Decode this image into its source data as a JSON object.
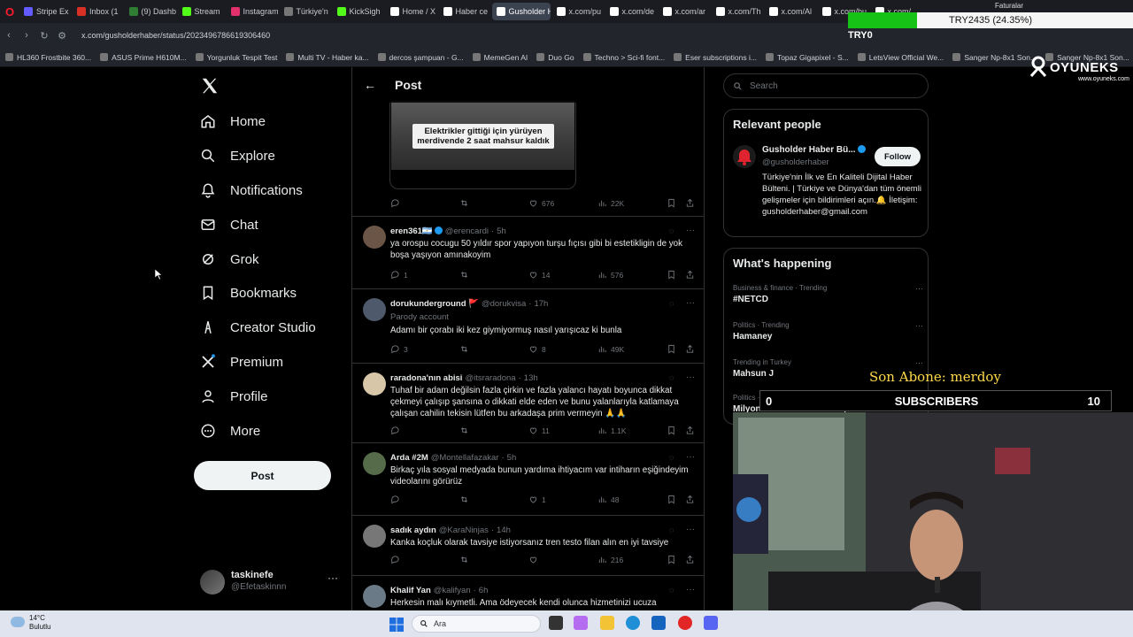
{
  "browser": {
    "tabs": [
      {
        "label": "Stripe Ex",
        "color": "#635bff",
        "active": false
      },
      {
        "label": "Inbox (1",
        "color": "#d93025",
        "active": false
      },
      {
        "label": "(9) Dashb",
        "color": "#2e7d32",
        "active": false
      },
      {
        "label": "Stream",
        "color": "#53fc18",
        "active": false
      },
      {
        "label": "Instagram",
        "color": "#e1306c",
        "active": false
      },
      {
        "label": "Türkiye'n",
        "color": "#777777",
        "active": false
      },
      {
        "label": "KickSigh",
        "color": "#53fc18",
        "active": false
      },
      {
        "label": "Home / X",
        "color": "#ffffff",
        "active": false
      },
      {
        "label": "Haber ce",
        "color": "#ffffff",
        "active": false
      },
      {
        "label": "Gusholder Hab",
        "color": "#ffffff",
        "active": true
      },
      {
        "label": "x.com/pu",
        "color": "#ffffff",
        "active": false
      },
      {
        "label": "x.com/de",
        "color": "#ffffff",
        "active": false
      },
      {
        "label": "x.com/ar",
        "color": "#ffffff",
        "active": false
      },
      {
        "label": "x.com/Th",
        "color": "#ffffff",
        "active": false
      },
      {
        "label": "x.com/Al",
        "color": "#ffffff",
        "active": false
      },
      {
        "label": "x.com/bu",
        "color": "#ffffff",
        "active": false
      },
      {
        "label": "x.com/",
        "color": "#ffffff",
        "active": false
      }
    ],
    "url": "x.com/gusholderhaber/status/2023496786619306460",
    "bookmarks": [
      "HL360 Frostbite 360...",
      "ASUS Prime H610M...",
      "Yorgunluk Tespit Test",
      "Multi TV - Haber ka...",
      "dercos şampuan - G...",
      "MemeGen AI",
      "Duo Go",
      "Techno > Sci-fi font...",
      "Eser subscriptions i...",
      "Topaz Gigapixel - S...",
      "LetsView Official We...",
      "Sanger Np-8x1 Son...",
      "Sanger Np-8x1 Son..."
    ]
  },
  "overlay": {
    "price_text": "TRY2435 (24.35%)",
    "price_fraction": 0.2435,
    "try0": "TRY0",
    "faturalar": "Faturalar",
    "oyuneks_brand": "OYUNEKS",
    "oyuneks_site": "www.oyuneks.com",
    "son_abone": "Son Abone: merdoy",
    "subs_start": "0",
    "subs_label": "SUBSCRIBERS",
    "subs_goal": "10"
  },
  "nav": {
    "items": [
      {
        "label": "Home",
        "icon": "home-icon"
      },
      {
        "label": "Explore",
        "icon": "search-icon"
      },
      {
        "label": "Notifications",
        "icon": "bell-icon"
      },
      {
        "label": "Chat",
        "icon": "mail-icon"
      },
      {
        "label": "Grok",
        "icon": "grok-icon"
      },
      {
        "label": "Bookmarks",
        "icon": "bookmark-icon"
      },
      {
        "label": "Creator Studio",
        "icon": "creator-icon"
      },
      {
        "label": "Premium",
        "icon": "x-premium-icon"
      },
      {
        "label": "Profile",
        "icon": "person-icon"
      },
      {
        "label": "More",
        "icon": "more-circle-icon"
      }
    ],
    "post_label": "Post",
    "account": {
      "name": "taskinefe",
      "handle": "@Efetaskinnn"
    }
  },
  "center": {
    "title": "Post",
    "media_caption": "Elektrikler gittiği için yürüyen merdivende 2 saat mahsur kaldık",
    "main_stats": {
      "likes": "676",
      "views": "22K"
    },
    "tweets": [
      {
        "name": "eren361🇦🇷",
        "verified": true,
        "handle": "@erencardi",
        "time": "5h",
        "text": "ya orospu cocugu 50 yıldır spor yapıyon turşu fıçısı gibi bi estetikligin de yok boşa yaşıyon amınakoyim",
        "replies": "1",
        "reposts": "",
        "likes": "14",
        "views": "576",
        "parody": ""
      },
      {
        "name": "dorukunderground 🚩",
        "verified": false,
        "handle": "@dorukvisa",
        "time": "17h",
        "text": "Adamı bir çorabı iki kez giymiyormuş nasıl yarışıcaz ki bunla",
        "replies": "3",
        "reposts": "",
        "likes": "8",
        "views": "49K",
        "parody": "Parody account"
      },
      {
        "name": "raradona'nın abisi",
        "verified": false,
        "handle": "@itsraradona",
        "time": "13h",
        "text": "Tuhaf bir adam değilsin fazla çirkin ve fazla yalancı hayatı boyunca dikkat çekmeyi çalışıp şansına o dikkati elde eden ve bunu yalanlarıyla katlamaya çalışan cahilin tekisin lütfen bu arkadaşa prim vermeyin 🙏🙏",
        "replies": "",
        "reposts": "",
        "likes": "11",
        "views": "1.1K",
        "parody": ""
      },
      {
        "name": "Arda #2M",
        "verified": false,
        "handle": "@Montellafazakar",
        "time": "5h",
        "text": "Birkaç yıla sosyal medyada bunun yardıma ihtiyacım var intiharın eşiğindeyim videolarını görürüz",
        "replies": "",
        "reposts": "",
        "likes": "1",
        "views": "48",
        "parody": ""
      },
      {
        "name": "sadık aydın",
        "verified": false,
        "handle": "@KaraNinjas",
        "time": "14h",
        "text": "Kanka koçluk olarak tavsiye istiyorsanız tren testo filan alın en iyi tavsiye",
        "replies": "",
        "reposts": "",
        "likes": "",
        "views": "216",
        "parody": ""
      },
      {
        "name": "Khalif Yan",
        "verified": false,
        "handle": "@kalifyan",
        "time": "6h",
        "text": "Herkesin malı kıymetli. Ama  ödeyecek kendi olunca hizmetinizi ucuza",
        "replies": "",
        "reposts": "",
        "likes": "",
        "views": "",
        "parody": ""
      }
    ]
  },
  "right": {
    "search_placeholder": "Search",
    "relevant_title": "Relevant people",
    "person": {
      "name": "Gusholder Haber Bü...",
      "handle": "@gusholderhaber",
      "follow": "Follow",
      "bio": "Türkiye'nin İlk ve En Kaliteli Dijital Haber Bülteni. | Türkiye ve Dünya'dan tüm önemli gelişmeler için bildirimleri açın.🔔 İletişim: gusholderhaber@gmail.com"
    },
    "happening_title": "What's happening",
    "trends": [
      {
        "context": "Business & finance · Trending",
        "name": "#NETCD"
      },
      {
        "context": "Politics · Trending",
        "name": "Hamaney"
      },
      {
        "context": "Trending in Turkey",
        "name": "Mahsun J"
      },
      {
        "context": "Politics · Trending",
        "name": "MilyonlarınTalebi ErkenSeçim"
      }
    ]
  },
  "taskbar": {
    "temp": "14°C",
    "weather": "Bulutlu",
    "search": "Ara"
  }
}
